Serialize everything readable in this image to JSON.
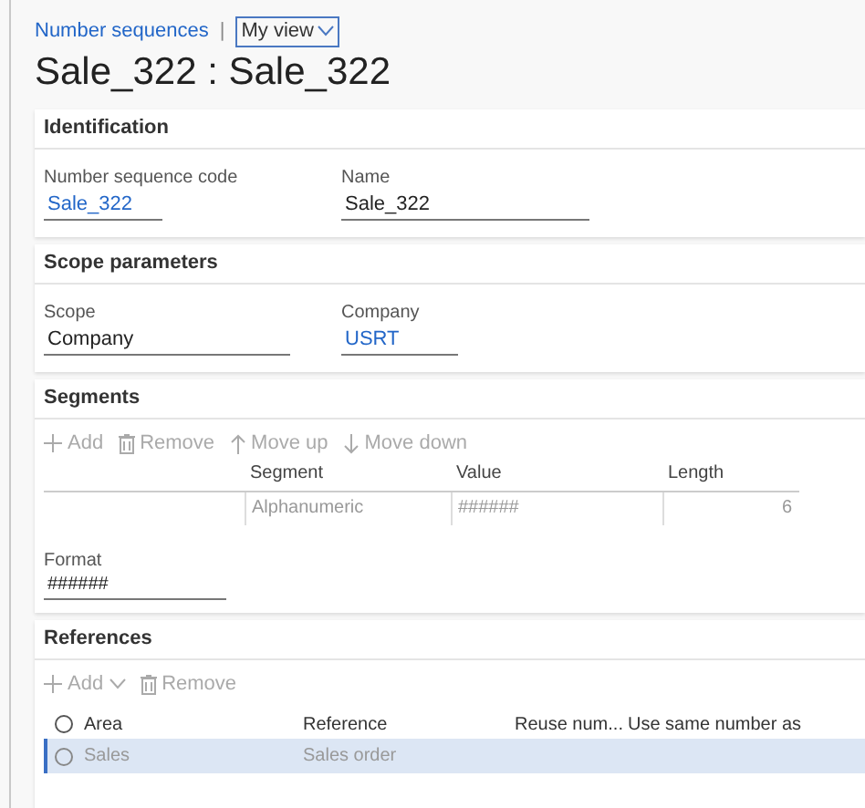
{
  "breadcrumb": {
    "link": "Number sequences",
    "separator": "|",
    "view_menu": "My view"
  },
  "title": "Sale_322 : Sale_322",
  "identification": {
    "header": "Identification",
    "fields": [
      {
        "label": "Number sequence code",
        "value": "Sale_322",
        "link": true
      },
      {
        "label": "Name",
        "value": "Sale_322",
        "link": false
      }
    ]
  },
  "scope_parameters": {
    "header": "Scope parameters",
    "fields": [
      {
        "label": "Scope",
        "value": "Company",
        "link": false
      },
      {
        "label": "Company",
        "value": "USRT",
        "link": true
      }
    ]
  },
  "segments": {
    "header": "Segments",
    "toolbar": [
      {
        "label": "Add",
        "kind": "add",
        "disabled": true
      },
      {
        "label": "Remove",
        "kind": "remove",
        "disabled": true
      },
      {
        "label": "Move up",
        "kind": "move_up",
        "disabled": true
      },
      {
        "label": "Move down",
        "kind": "move_down",
        "disabled": true
      }
    ],
    "columns": [
      "Segment",
      "Value",
      "Length"
    ],
    "rows": [
      {
        "segment": "Alphanumeric",
        "value": "######",
        "length": "6"
      }
    ],
    "format": {
      "label": "Format",
      "value": "######"
    }
  },
  "references": {
    "header": "References",
    "toolbar": [
      {
        "label": "Add",
        "kind": "add_menu",
        "disabled": true
      },
      {
        "label": "Remove",
        "kind": "remove",
        "disabled": true
      }
    ],
    "all_selected": false,
    "columns": [
      "Area",
      "Reference",
      "Reuse num...",
      "Use same number as"
    ],
    "rows": [
      {
        "area": "Sales",
        "reference": "Sales order",
        "selected": true
      }
    ]
  }
}
